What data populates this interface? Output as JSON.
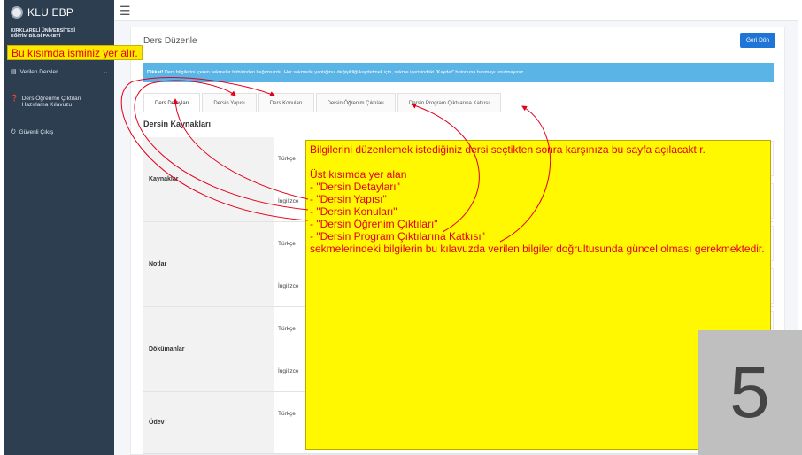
{
  "sidebar": {
    "brand": "KLU EBP",
    "university_line1": "KIRKLARELİ ÜNİVERSİTESİ",
    "university_line2": "EĞİTİM BİLGİ PAKETİ",
    "items": [
      {
        "label": "Verilen Dersler",
        "icon": "book-icon"
      },
      {
        "label_line1": "Ders Öğrenme Çıktıları",
        "label_line2": "Hazırlama Kılavuzu",
        "icon": "question-circle-icon"
      },
      {
        "label": "Güvenli Çıkış",
        "icon": "power-icon"
      }
    ]
  },
  "annotation_name": "Bu kısımda isminiz yer alır.",
  "header": {
    "title": "Ders Düzenle",
    "back_label": "Geri Dön"
  },
  "alert": {
    "bold": "Dikkat!",
    "text": " Ders bilgilerini içeren sekmeler birbirinden bağımsızdır. Her sekmede yaptığınız değişikliği kaydetmek için, sekme içerisindeki \"Kaydet\" butonuna basmayı unutmayınız."
  },
  "tabs": [
    "Ders Detayları",
    "Dersin Yapısı",
    "Ders Konuları",
    "Dersin Öğrenim Çıktıları",
    "Dersin Program Çıktılarına Katkısı"
  ],
  "section_title": "Dersin Kaynakları",
  "rows": [
    {
      "label": "Kaynaklar",
      "lang1": "Türkçe",
      "lang2": "İngilizce"
    },
    {
      "label": "Notlar",
      "lang1": "Türkçe",
      "lang2": "İngilizce"
    },
    {
      "label": "Dökümanlar",
      "lang1": "Türkçe",
      "lang2": "İngilizce"
    },
    {
      "label": "Ödev",
      "lang1": "Türkçe",
      "lang2": ""
    }
  ],
  "annotation_main": {
    "line1": "Bilgilerini düzenlemek istediğiniz dersi seçtikten sonra karşınıza bu sayfa açılacaktır.",
    "line2": "Üst kısımda yer alan",
    "line3": "- \"Dersin Detayları\"",
    "line4": "- \"Dersin Yapısı\"",
    "line5": "- \"Dersin Konuları\"",
    "line6": "- \"Dersin Öğrenim Çıktıları\"",
    "line7": "- \"Dersin Program Çıktılarına Katkısı\"",
    "line8": "sekmelerindeki bilgilerin bu kılavuzda verilen bilgiler doğrultusunda güncel olması gerekmektedir."
  },
  "slide_number": "5",
  "colors": {
    "sidebar": "#2c3e50",
    "primary": "#1f75d6",
    "alert": "#5ab4e5",
    "annotation_bg": "#fff800",
    "annotation_text": "#e2001a"
  }
}
